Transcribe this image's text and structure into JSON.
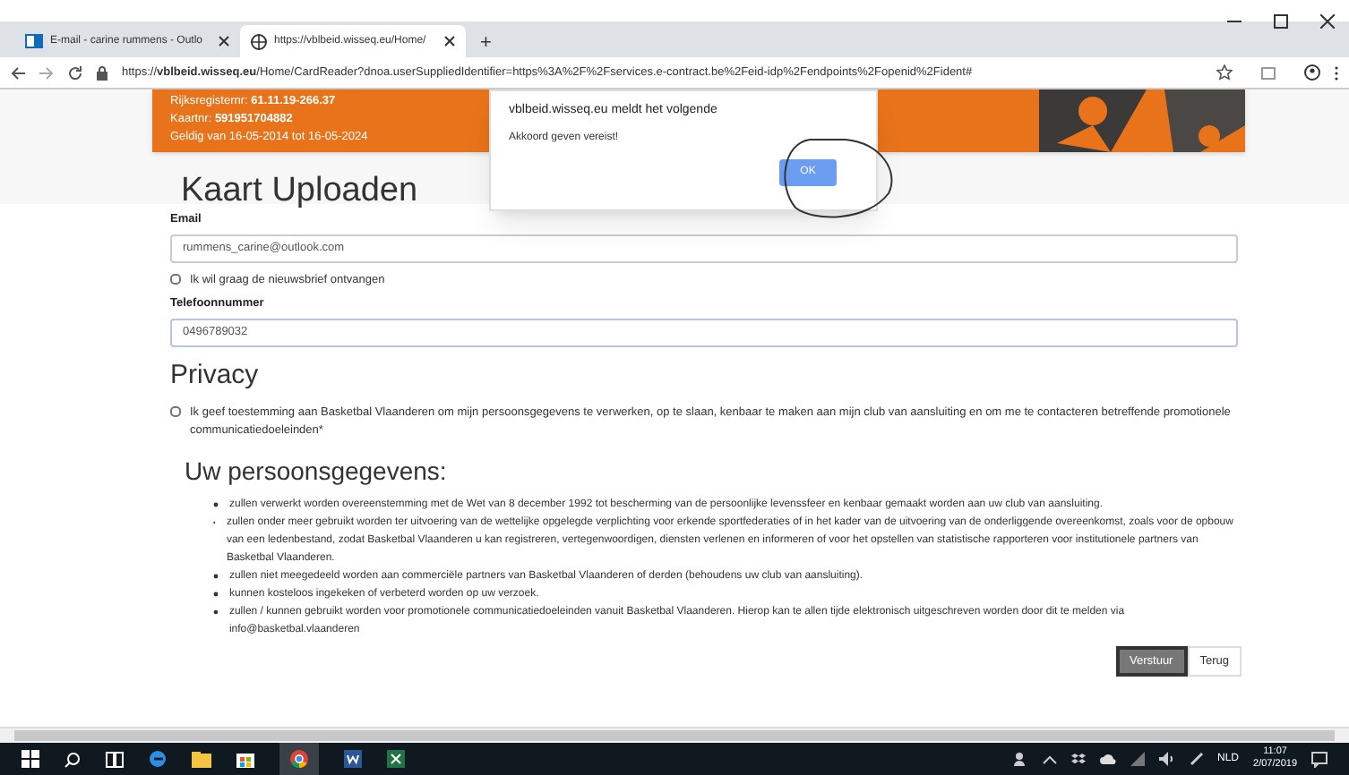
{
  "browser": {
    "tabs": [
      {
        "label": "E-mail - carine rummens - Outlo",
        "selected": false
      },
      {
        "label": "https://vblbeid.wisseq.eu/Home/",
        "selected": true
      }
    ],
    "new_tab": "+",
    "url": "https://**vblbeid.wisseq.eu**/Home/CardReader?dnoa.userSuppliedIdentifier=https%3A%2F%2Fservices.e-contract.be%2Feid-idp%2Fendpoints%2Fopenid%2Fident#"
  },
  "card": {
    "lines": [
      "Rijksregisternr: **61.11.19-266.37**",
      "Kaartnr: **591951704882**",
      "Geldig van 16-05-2014 tot 16-05-2024"
    ]
  },
  "dialog": {
    "title": "vblbeid.wisseq.eu meldt het volgende",
    "message": "Akkoord geven vereist!",
    "button": "OK"
  },
  "page_title": "Kaart Uploaden",
  "email": {
    "label": "Email",
    "value": "rummens_carine@outlook.com"
  },
  "newsletter": {
    "label": "Ik wil graag de nieuwsbrief ontvangen",
    "checked": false
  },
  "phone": {
    "label": "Telefoonnummer",
    "value": "0496789032"
  },
  "privacy": {
    "heading": "Privacy",
    "consent": "Ik geef toestemming aan Basketbal Vlaanderen om mijn persoonsgegevens te verwerken, op te slaan, kenbaar te maken aan mijn club van aansluiting en om me te contacteren betreffende promotionele communicatiedoeleinden*",
    "checked": false
  },
  "details": {
    "heading": "Uw persoonsgegevens:",
    "items": [
      "zullen verwerkt worden overeenstemming met de Wet van 8 december 1992 tot bescherming van de persoonlijke levenssfeer en kenbaar gemaakt worden aan uw club van aansluiting.",
      "zullen onder meer gebruikt worden ter uitvoering van de wettelijke opgelegde verplichting voor erkende sportfederaties of in het kader van de uitvoering van de onderliggende overeenkomst, zoals voor de opbouw van een ledenbestand, zodat Basketbal Vlaanderen u kan registreren, vertegenwoordigen, diensten verlenen en informeren of voor het opstellen van statistische rapporteren voor institutionele partners van Basketbal Vlaanderen.",
      "zullen niet meegedeeld worden aan commerciële partners van Basketbal Vlaanderen of derden (behoudens uw club van aansluiting).",
      "kunnen kosteloos ingekeken of verbeterd worden op uw verzoek.",
      "zullen / kunnen gebruikt worden voor promotionele communicatiedoeleinden vanuit Basketbal Vlaanderen. Hierop kan te allen tijde elektronisch uitgeschreven worden door dit te melden via info@basketbal.vlaanderen"
    ]
  },
  "buttons": [
    {
      "label": "Verstuur",
      "kind": "primary"
    },
    {
      "label": "Terug",
      "kind": "default"
    }
  ],
  "taskbar": {
    "language": "NLD",
    "time": "11:07",
    "date": "2/07/2019"
  }
}
